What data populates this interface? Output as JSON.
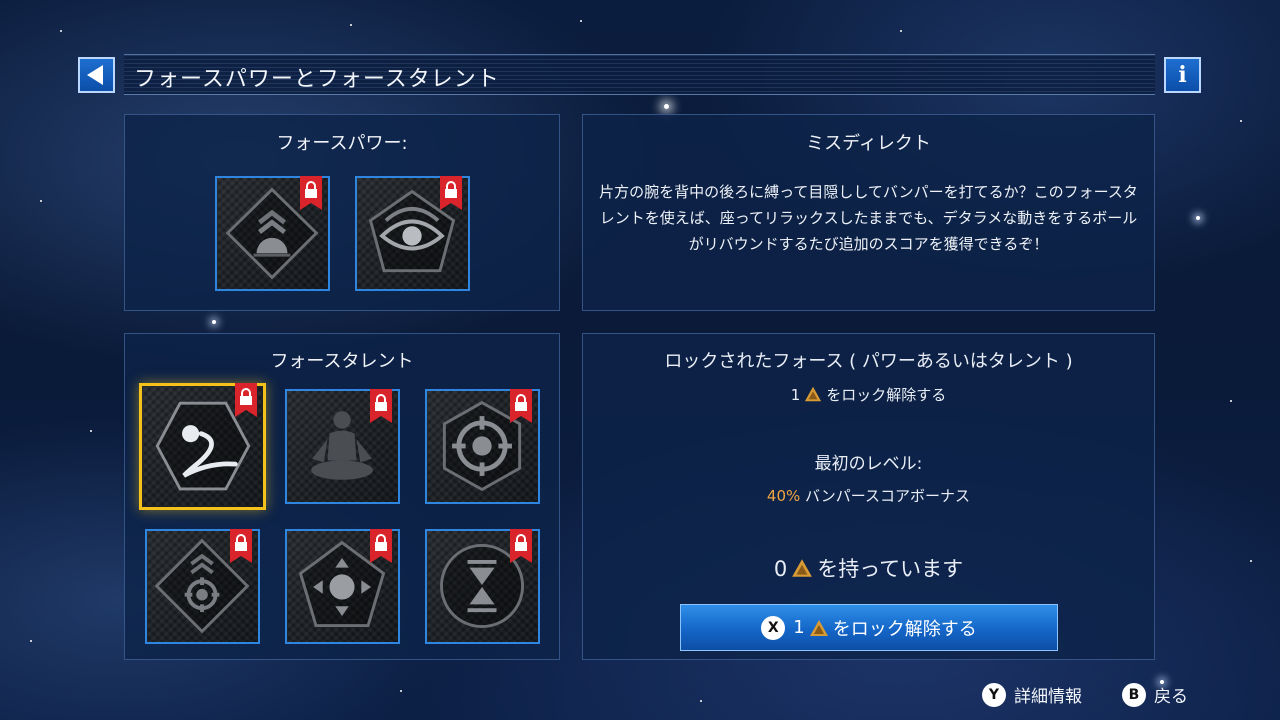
{
  "header": {
    "title": "フォースパワーとフォースタレント",
    "info_label": "i"
  },
  "powers": {
    "title": "フォースパワー:",
    "items": [
      {
        "icon": "chevrons-ball-icon",
        "locked": true
      },
      {
        "icon": "eye-icon",
        "locked": true
      }
    ]
  },
  "description": {
    "title": "ミスディレクト",
    "body": "片方の腕を背中の後ろに縛って目隠ししてバンパーを打てるか？このフォースタレントを使えば、座ってリラックスしたままでも、デタラメな動きをするボールがリバウンドするたび追加のスコアを獲得できるぞ！"
  },
  "talents": {
    "title": "フォースタレント",
    "items": [
      {
        "icon": "deflect-ball-icon",
        "locked": true,
        "selected": true
      },
      {
        "icon": "meditation-icon",
        "locked": true
      },
      {
        "icon": "crosshair-icon",
        "locked": true
      },
      {
        "icon": "chevrons-crosshair-icon",
        "locked": true
      },
      {
        "icon": "ball-arrows-icon",
        "locked": true
      },
      {
        "icon": "hourglass-icon",
        "locked": true
      }
    ]
  },
  "locked_panel": {
    "title": "ロックされたフォース ( パワーあるいはタレント )",
    "cost_value": "1",
    "cost_suffix": "をロック解除する",
    "level_title": "最初のレベル:",
    "bonus_percent": "40%",
    "bonus_text": "バンパースコアボーナス",
    "owned_value": "0",
    "owned_suffix": "を持っています",
    "unlock_button": {
      "key": "X",
      "value": "1",
      "label": "をロック解除する"
    }
  },
  "footer": {
    "details": {
      "key": "Y",
      "label": "詳細情報"
    },
    "back": {
      "key": "B",
      "label": "戻る"
    }
  },
  "colors": {
    "accent_blue": "#2f86e0",
    "selected_gold": "#f4c21b",
    "lock_red": "#d8242a",
    "highlight_orange": "#f0a640"
  }
}
